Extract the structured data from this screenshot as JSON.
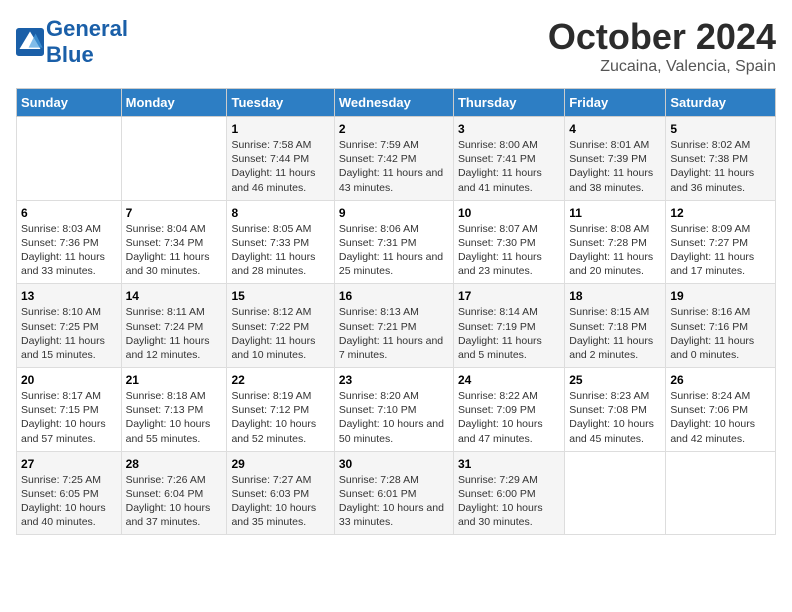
{
  "header": {
    "logo_general": "General",
    "logo_blue": "Blue",
    "month": "October 2024",
    "location": "Zucaina, Valencia, Spain"
  },
  "weekdays": [
    "Sunday",
    "Monday",
    "Tuesday",
    "Wednesday",
    "Thursday",
    "Friday",
    "Saturday"
  ],
  "weeks": [
    [
      {
        "day": "",
        "info": ""
      },
      {
        "day": "",
        "info": ""
      },
      {
        "day": "1",
        "info": "Sunrise: 7:58 AM\nSunset: 7:44 PM\nDaylight: 11 hours and 46 minutes."
      },
      {
        "day": "2",
        "info": "Sunrise: 7:59 AM\nSunset: 7:42 PM\nDaylight: 11 hours and 43 minutes."
      },
      {
        "day": "3",
        "info": "Sunrise: 8:00 AM\nSunset: 7:41 PM\nDaylight: 11 hours and 41 minutes."
      },
      {
        "day": "4",
        "info": "Sunrise: 8:01 AM\nSunset: 7:39 PM\nDaylight: 11 hours and 38 minutes."
      },
      {
        "day": "5",
        "info": "Sunrise: 8:02 AM\nSunset: 7:38 PM\nDaylight: 11 hours and 36 minutes."
      }
    ],
    [
      {
        "day": "6",
        "info": "Sunrise: 8:03 AM\nSunset: 7:36 PM\nDaylight: 11 hours and 33 minutes."
      },
      {
        "day": "7",
        "info": "Sunrise: 8:04 AM\nSunset: 7:34 PM\nDaylight: 11 hours and 30 minutes."
      },
      {
        "day": "8",
        "info": "Sunrise: 8:05 AM\nSunset: 7:33 PM\nDaylight: 11 hours and 28 minutes."
      },
      {
        "day": "9",
        "info": "Sunrise: 8:06 AM\nSunset: 7:31 PM\nDaylight: 11 hours and 25 minutes."
      },
      {
        "day": "10",
        "info": "Sunrise: 8:07 AM\nSunset: 7:30 PM\nDaylight: 11 hours and 23 minutes."
      },
      {
        "day": "11",
        "info": "Sunrise: 8:08 AM\nSunset: 7:28 PM\nDaylight: 11 hours and 20 minutes."
      },
      {
        "day": "12",
        "info": "Sunrise: 8:09 AM\nSunset: 7:27 PM\nDaylight: 11 hours and 17 minutes."
      }
    ],
    [
      {
        "day": "13",
        "info": "Sunrise: 8:10 AM\nSunset: 7:25 PM\nDaylight: 11 hours and 15 minutes."
      },
      {
        "day": "14",
        "info": "Sunrise: 8:11 AM\nSunset: 7:24 PM\nDaylight: 11 hours and 12 minutes."
      },
      {
        "day": "15",
        "info": "Sunrise: 8:12 AM\nSunset: 7:22 PM\nDaylight: 11 hours and 10 minutes."
      },
      {
        "day": "16",
        "info": "Sunrise: 8:13 AM\nSunset: 7:21 PM\nDaylight: 11 hours and 7 minutes."
      },
      {
        "day": "17",
        "info": "Sunrise: 8:14 AM\nSunset: 7:19 PM\nDaylight: 11 hours and 5 minutes."
      },
      {
        "day": "18",
        "info": "Sunrise: 8:15 AM\nSunset: 7:18 PM\nDaylight: 11 hours and 2 minutes."
      },
      {
        "day": "19",
        "info": "Sunrise: 8:16 AM\nSunset: 7:16 PM\nDaylight: 11 hours and 0 minutes."
      }
    ],
    [
      {
        "day": "20",
        "info": "Sunrise: 8:17 AM\nSunset: 7:15 PM\nDaylight: 10 hours and 57 minutes."
      },
      {
        "day": "21",
        "info": "Sunrise: 8:18 AM\nSunset: 7:13 PM\nDaylight: 10 hours and 55 minutes."
      },
      {
        "day": "22",
        "info": "Sunrise: 8:19 AM\nSunset: 7:12 PM\nDaylight: 10 hours and 52 minutes."
      },
      {
        "day": "23",
        "info": "Sunrise: 8:20 AM\nSunset: 7:10 PM\nDaylight: 10 hours and 50 minutes."
      },
      {
        "day": "24",
        "info": "Sunrise: 8:22 AM\nSunset: 7:09 PM\nDaylight: 10 hours and 47 minutes."
      },
      {
        "day": "25",
        "info": "Sunrise: 8:23 AM\nSunset: 7:08 PM\nDaylight: 10 hours and 45 minutes."
      },
      {
        "day": "26",
        "info": "Sunrise: 8:24 AM\nSunset: 7:06 PM\nDaylight: 10 hours and 42 minutes."
      }
    ],
    [
      {
        "day": "27",
        "info": "Sunrise: 7:25 AM\nSunset: 6:05 PM\nDaylight: 10 hours and 40 minutes."
      },
      {
        "day": "28",
        "info": "Sunrise: 7:26 AM\nSunset: 6:04 PM\nDaylight: 10 hours and 37 minutes."
      },
      {
        "day": "29",
        "info": "Sunrise: 7:27 AM\nSunset: 6:03 PM\nDaylight: 10 hours and 35 minutes."
      },
      {
        "day": "30",
        "info": "Sunrise: 7:28 AM\nSunset: 6:01 PM\nDaylight: 10 hours and 33 minutes."
      },
      {
        "day": "31",
        "info": "Sunrise: 7:29 AM\nSunset: 6:00 PM\nDaylight: 10 hours and 30 minutes."
      },
      {
        "day": "",
        "info": ""
      },
      {
        "day": "",
        "info": ""
      }
    ]
  ]
}
